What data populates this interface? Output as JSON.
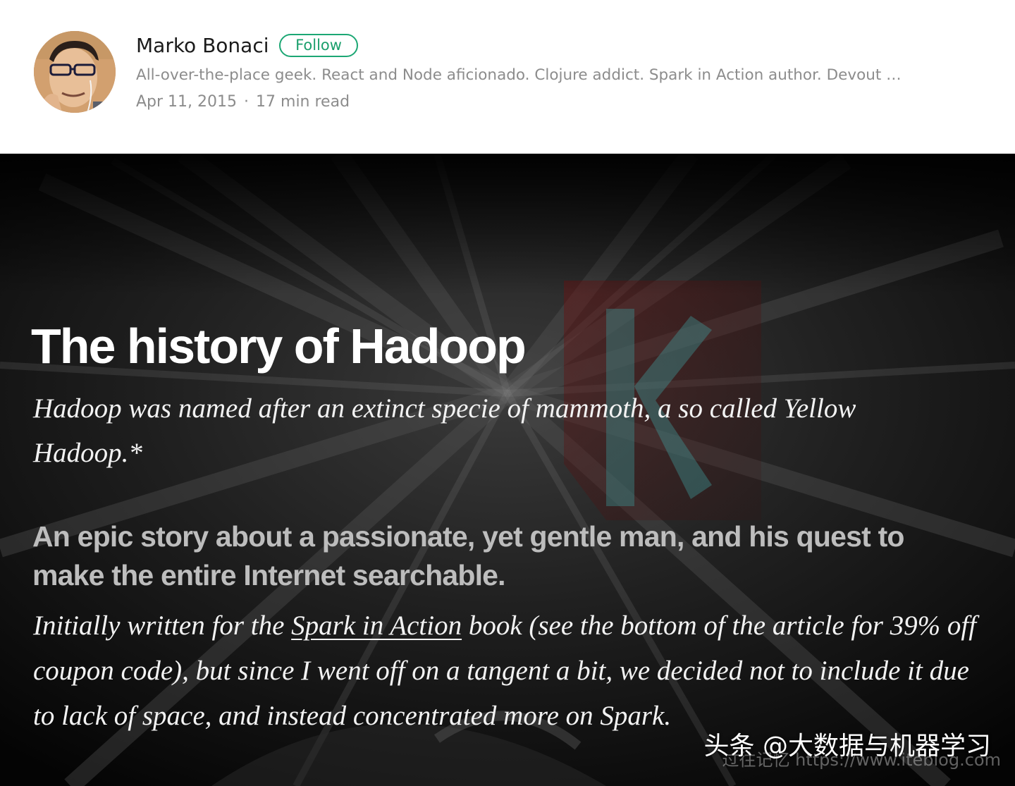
{
  "author": {
    "name": "Marko Bonaci",
    "follow_label": "Follow",
    "bio": "All-over-the-place geek. React and Node aficionado. Clojure addict. Spark in Action author. Devout …",
    "date": "Apr 11, 2015",
    "separator": "·",
    "read_time": "17 min read"
  },
  "article": {
    "title": "The history of Hadoop",
    "subtitle": "Hadoop was named after an extinct specie of mammoth, a so called Yellow Hadoop.*",
    "lede": "An epic story about a passionate, yet gentle man, and his quest to make the entire Internet searchable.",
    "body_before_link": "Initially written for the ",
    "body_link": "Spark in Action",
    "body_after_link": " book (see the bottom of the article for 39% off coupon code), but since I went off on a tangent a bit, we decided not to include it due to lack of space, and instead concentrated more on Spark."
  },
  "watermark": {
    "main": "头条 @大数据与机器学习",
    "url": "过往记忆 https://www.iteblog.com"
  },
  "colors": {
    "follow_green": "#1ca774",
    "meta_gray": "#8c8c8c",
    "hero_background": "#050505",
    "lede_gray": "#bdbdbd"
  }
}
